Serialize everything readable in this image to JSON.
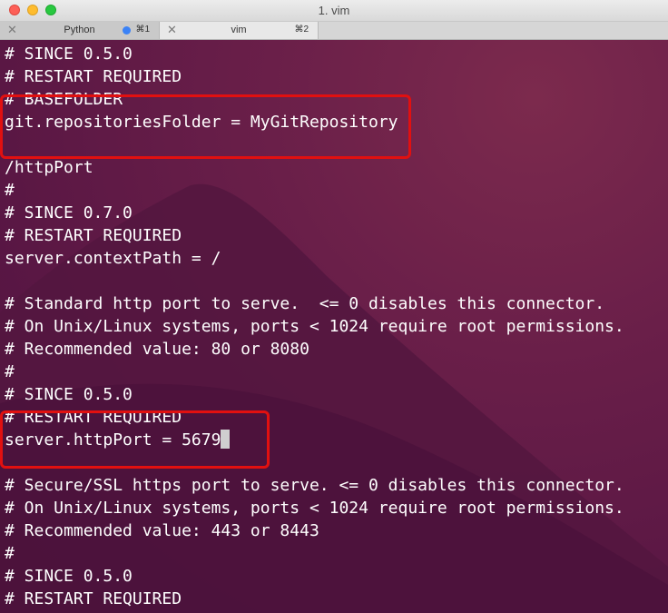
{
  "window": {
    "title": "1. vim"
  },
  "tabs": [
    {
      "label": "Python",
      "shortcut": "⌘1",
      "active": true
    },
    {
      "label": "vim",
      "shortcut": "⌘2",
      "active": false
    }
  ],
  "editor": {
    "lines": [
      "# SINCE 0.5.0",
      "# RESTART REQUIRED",
      "# BASEFOLDER",
      "git.repositoriesFolder = MyGitRepository",
      "",
      "/httpPort",
      "#",
      "# SINCE 0.7.0",
      "# RESTART REQUIRED",
      "server.contextPath = /",
      "",
      "# Standard http port to serve.  <= 0 disables this connector.",
      "# On Unix/Linux systems, ports < 1024 require root permissions.",
      "# Recommended value: 80 or 8080",
      "#",
      "# SINCE 0.5.0",
      "# RESTART REQUIRED",
      "server.httpPort = 5679",
      "",
      "# Secure/SSL https port to serve. <= 0 disables this connector.",
      "# On Unix/Linux systems, ports < 1024 require root permissions.",
      "# Recommended value: 443 or 8443",
      "#",
      "# SINCE 0.5.0",
      "# RESTART REQUIRED"
    ]
  },
  "colors": {
    "annotation": "#e11010",
    "text": "#ffffff",
    "background": "#5a1744"
  }
}
